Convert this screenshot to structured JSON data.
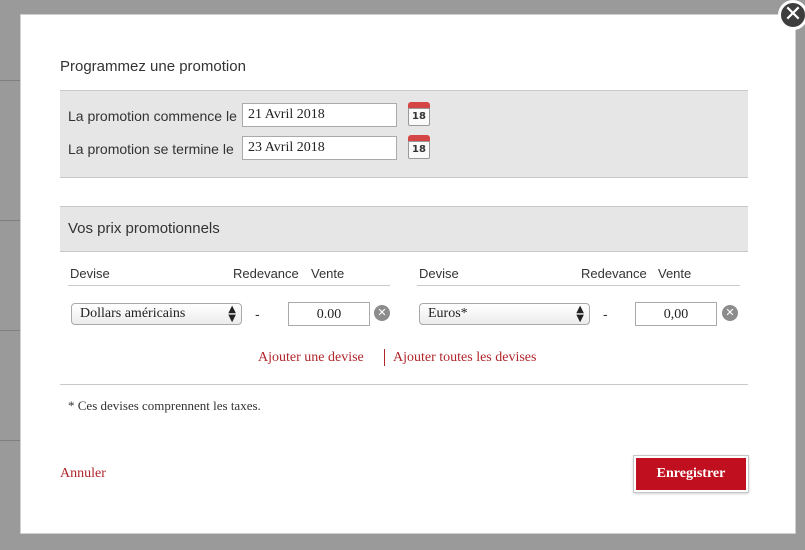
{
  "dialog": {
    "close_icon": "close-icon",
    "title": "Programmez une promotion",
    "start": {
      "label": "La promotion commence le",
      "value": "21 Avril 2018",
      "calendar_day": "18"
    },
    "end": {
      "label": "La promotion se termine le",
      "value": "23 Avril 2018",
      "calendar_day": "18"
    },
    "prices": {
      "title": "Vos prix promotionnels",
      "columns": [
        "Devise",
        "Redevance",
        "Vente"
      ],
      "rows": [
        {
          "currency": "Dollars américains",
          "redevance": "-",
          "vente": "0.00"
        },
        {
          "currency": "Euros*",
          "redevance": "-",
          "vente": "0,00"
        }
      ]
    },
    "links": {
      "add_currency": "Ajouter une devise",
      "add_all_currencies": "Ajouter toutes les devises"
    },
    "note": "* Ces devises comprennent les taxes.",
    "cancel_label": "Annuler",
    "save_label": "Enregistrer",
    "accent_color": "#c0101f",
    "link_color": "#b0262b"
  }
}
